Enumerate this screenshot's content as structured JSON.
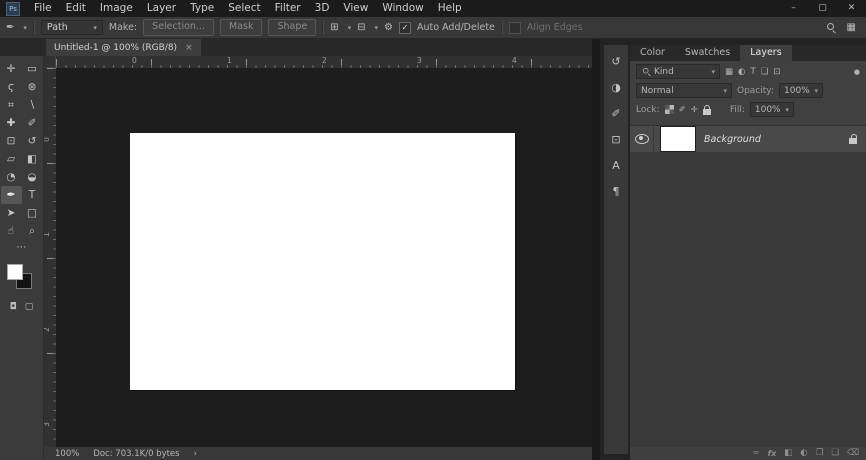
{
  "app": {
    "name": "Ps",
    "menu_items": [
      "File",
      "Edit",
      "Image",
      "Layer",
      "Type",
      "Select",
      "Filter",
      "3D",
      "View",
      "Window",
      "Help"
    ],
    "window_controls": {
      "minimize": "–",
      "maximize": "▢",
      "close": "✕"
    }
  },
  "glyphs": {
    "caret": "▾",
    "gear": "⚙",
    "check": "✓",
    "workspace": "▦",
    "preset": "✒",
    "toggle": "●"
  },
  "options_bar": {
    "mode_value": "Path",
    "make_label": "Make:",
    "buttons": {
      "selection": "Selection...",
      "mask": "Mask",
      "shape": "Shape"
    },
    "ops_icons": [
      {
        "name": "path-operations",
        "glyph": "⊞"
      },
      {
        "name": "path-alignment",
        "glyph": "⊟"
      }
    ],
    "auto_add_delete_label": "Auto Add/Delete",
    "align_edges_label": "Align Edges"
  },
  "tabs": {
    "document": {
      "title": "Untitled-1 @ 100% (RGB/8)",
      "close_glyph": "×"
    }
  },
  "toolbar": {
    "tools": [
      {
        "name": "move",
        "glyph": "✛"
      },
      {
        "name": "rectangular-marquee",
        "glyph": "▭"
      },
      {
        "name": "lasso",
        "glyph": "ϛ"
      },
      {
        "name": "quick-selection",
        "glyph": "⊛"
      },
      {
        "name": "crop",
        "glyph": "⌗"
      },
      {
        "name": "eyedropper",
        "glyph": "∖"
      },
      {
        "name": "healing-brush",
        "glyph": "✚"
      },
      {
        "name": "brush",
        "glyph": "✐"
      },
      {
        "name": "clone-stamp",
        "glyph": "⊡"
      },
      {
        "name": "history-brush",
        "glyph": "↺"
      },
      {
        "name": "eraser",
        "glyph": "▱"
      },
      {
        "name": "gradient",
        "glyph": "◧"
      },
      {
        "name": "blur",
        "glyph": "◔"
      },
      {
        "name": "dodge",
        "glyph": "◒"
      },
      {
        "name": "pen",
        "glyph": "✒",
        "selected": true
      },
      {
        "name": "type",
        "glyph": "T"
      },
      {
        "name": "path-selection",
        "glyph": "➤"
      },
      {
        "name": "rectangle",
        "glyph": "□"
      },
      {
        "name": "hand",
        "glyph": "☝"
      },
      {
        "name": "zoom",
        "glyph": "⌕"
      }
    ],
    "more_glyph": "⋯",
    "colors": {
      "foreground": "#ffffff",
      "background": "#131313"
    },
    "mode_icons": [
      {
        "name": "quick-mask",
        "glyph": "◘"
      },
      {
        "name": "screen-mode",
        "glyph": "▢"
      }
    ]
  },
  "rulers": {
    "top_numbers": [
      "0",
      "1",
      "2",
      "3",
      "4"
    ],
    "left_numbers": [
      "0",
      "1",
      "2",
      "3"
    ]
  },
  "status_bar": {
    "zoom": "100%",
    "doc_info": "Doc: 703.1K/0 bytes",
    "chevron": "›"
  },
  "dock": {
    "icons": [
      {
        "name": "history",
        "glyph": "↺"
      },
      {
        "name": "properties",
        "glyph": "◑"
      },
      {
        "name": "brush-settings",
        "glyph": "✐"
      },
      {
        "name": "clone-source",
        "glyph": "⊡"
      },
      {
        "name": "character",
        "glyph": "A"
      },
      {
        "name": "paragraph",
        "glyph": "¶"
      }
    ]
  },
  "right_panel": {
    "tabs": [
      {
        "label": "Color",
        "active": false
      },
      {
        "label": "Swatches",
        "active": false
      },
      {
        "label": "Layers",
        "active": true
      }
    ],
    "layers_panel": {
      "kind_value": "Kind",
      "filter_icons": [
        {
          "name": "pixel-layers",
          "glyph": "▦"
        },
        {
          "name": "adjustment-layers",
          "glyph": "◐"
        },
        {
          "name": "type-layers",
          "glyph": "T"
        },
        {
          "name": "shape-layers",
          "glyph": "❏"
        },
        {
          "name": "smart-objects",
          "glyph": "⊡"
        }
      ],
      "blend_mode": "Normal",
      "opacity_label": "Opacity:",
      "opacity_value": "100%",
      "lock_label": "Lock:",
      "fill_label": "Fill:",
      "fill_value": "100%",
      "layer_name": "Background",
      "bottom_icons": [
        {
          "name": "link-layers",
          "glyph": "∞"
        },
        {
          "name": "layer-style",
          "glyph": "fx"
        },
        {
          "name": "layer-mask",
          "glyph": "◧"
        },
        {
          "name": "adjustment-layer",
          "glyph": "◐"
        },
        {
          "name": "layer-group",
          "glyph": "❐"
        },
        {
          "name": "new-layer",
          "glyph": "❏"
        },
        {
          "name": "delete-layer",
          "glyph": "⌫"
        }
      ]
    }
  }
}
